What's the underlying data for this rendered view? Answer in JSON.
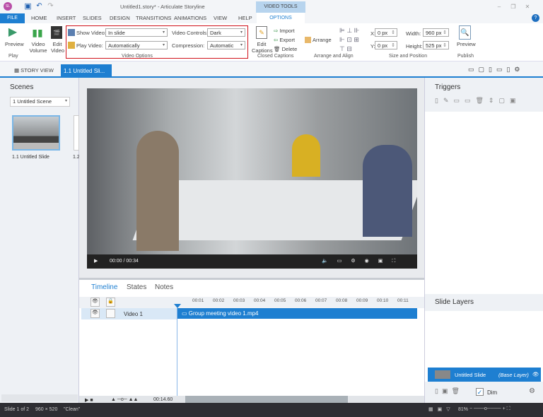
{
  "app": {
    "title": "Untitled1.story* - Articulate Storyline",
    "logo": "SL"
  },
  "tabs": {
    "file": "FILE",
    "items": [
      "HOME",
      "INSERT",
      "SLIDES",
      "DESIGN",
      "TRANSITIONS",
      "ANIMATIONS",
      "VIEW",
      "HELP"
    ],
    "context_group": "VIDEO TOOLS",
    "context_tab": "OPTIONS"
  },
  "ribbon": {
    "play": {
      "preview": "Preview",
      "group": "Play"
    },
    "video_volume": "Video Volume",
    "edit_video": "Edit Video",
    "video_options": {
      "group": "Video Options",
      "show_video_label": "Show Video:",
      "show_video_value": "In slide",
      "play_video_label": "Play Video:",
      "play_video_value": "Automatically",
      "controls_label": "Video Controls:",
      "controls_value": "Dark",
      "compression_label": "Compression:",
      "compression_value": "Automatic"
    },
    "captions": {
      "edit": "Edit Captions",
      "import": "Import",
      "export": "Export",
      "delete": "Delete",
      "group": "Closed Captions"
    },
    "arrange": {
      "arrange": "Arrange",
      "group": "Arrange and Align"
    },
    "size": {
      "x_label": "X:",
      "x_value": "0 px",
      "y_label": "Y:",
      "y_value": "0 px",
      "width_label": "Width:",
      "width_value": "960 px",
      "height_label": "Height:",
      "height_value": "525 px",
      "group": "Size and Position"
    },
    "publish": {
      "preview": "Preview",
      "group": "Publish"
    },
    "highlight_color": "#d0121b"
  },
  "doctabs": {
    "story_view": "STORY VIEW",
    "active": "1.1 Untitled Sli..."
  },
  "scenes": {
    "title": "Scenes",
    "dropdown": "1 Untitled Scene",
    "thumb_label": "1.1 Untitled Slide",
    "thumb2_label": "1.2"
  },
  "video": {
    "time": "00:00 / 00:34"
  },
  "timeline": {
    "tabs": [
      "Timeline",
      "States",
      "Notes"
    ],
    "ticks": [
      "00:01",
      "00:02",
      "00:03",
      "00:04",
      "00:05",
      "00:06",
      "00:07",
      "00:08",
      "00:09",
      "00:10",
      "00:11"
    ],
    "layer_name": "Video 1",
    "clip_name": "Group meeting video 1.mp4",
    "end_time": "00:14.60"
  },
  "triggers": {
    "title": "Triggers"
  },
  "layers": {
    "title": "Slide Layers",
    "base_name": "Untitled Slide",
    "base_tag": "(Base Layer)",
    "dim": "Dim"
  },
  "status": {
    "slide": "Slide 1 of 2",
    "size": "960 × 520",
    "theme": "\"Clean\"",
    "zoom": "81%"
  },
  "colors": {
    "accent": "#1e7fd1",
    "status_bg": "#2e2e33"
  }
}
